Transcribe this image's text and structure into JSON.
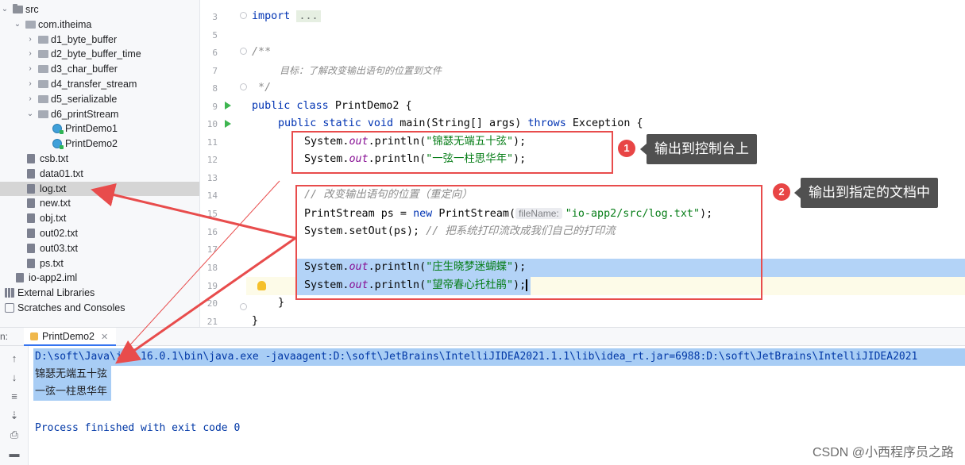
{
  "tree": {
    "items": [
      {
        "label": "src",
        "icon": "folder",
        "arrow": "v"
      },
      {
        "label": "com.itheima",
        "icon": "package",
        "arrow": "v"
      },
      {
        "label": "d1_byte_buffer",
        "icon": "package",
        "arrow": ">"
      },
      {
        "label": "d2_byte_buffer_time",
        "icon": "package",
        "arrow": ">"
      },
      {
        "label": "d3_char_buffer",
        "icon": "package",
        "arrow": ">"
      },
      {
        "label": "d4_transfer_stream",
        "icon": "package",
        "arrow": ">"
      },
      {
        "label": "d5_serializable",
        "icon": "package",
        "arrow": ">"
      },
      {
        "label": "d6_printStream",
        "icon": "package",
        "arrow": "v"
      },
      {
        "label": "PrintDemo1",
        "icon": "class"
      },
      {
        "label": "PrintDemo2",
        "icon": "class"
      },
      {
        "label": "csb.txt",
        "icon": "file"
      },
      {
        "label": "data01.txt",
        "icon": "file"
      },
      {
        "label": "log.txt",
        "icon": "file",
        "selected": true
      },
      {
        "label": "new.txt",
        "icon": "file"
      },
      {
        "label": "obj.txt",
        "icon": "file"
      },
      {
        "label": "out02.txt",
        "icon": "file"
      },
      {
        "label": "out03.txt",
        "icon": "file"
      },
      {
        "label": "ps.txt",
        "icon": "file"
      },
      {
        "label": "io-app2.iml",
        "icon": "file"
      },
      {
        "label": "External Libraries",
        "icon": "library",
        "arrow": ">"
      },
      {
        "label": "Scratches and Consoles",
        "icon": "scratch",
        "arrow": ">"
      }
    ]
  },
  "editor": {
    "line_numbers": [
      "3",
      "5",
      "6",
      "7",
      "8",
      "9",
      "10",
      "11",
      "12",
      "13",
      "14",
      "15",
      "16",
      "17",
      "18",
      "19",
      "20",
      "21"
    ],
    "lines": {
      "l3_import": "import ",
      "l3_fold": "...",
      "l6": "/**",
      "l7": "目标：了解改变输出语句的位置到文件",
      "l8": " */",
      "l9_kw": "public class ",
      "l9_rest": "PrintDemo2 {",
      "l10_kw1": "public static void ",
      "l10_mid": "main(String[] args) ",
      "l10_kw2": "throws ",
      "l10_rest": "Exception {",
      "sys": "System.",
      "out": "out",
      "println": ".println(",
      "s11": "\"锦瑟无端五十弦\"",
      "s12": "\"一弦一柱思华年\"",
      "end": ");",
      "l14": "// 改变输出语句的位置（重定向）",
      "l15_a": "PrintStream ps = ",
      "l15_new": "new ",
      "l15_b": "PrintStream(",
      "l15_hint": "fileName:",
      "l15_str": "\"io-app2/src/log.txt\"",
      "l16_a": "System.setOut(ps); ",
      "l16_cm": "// 把系统打印流改成我们自己的打印流",
      "s18": "\"庄生晓梦迷蝴蝶\"",
      "s19": "\"望帝春心托杜鹃\"",
      "l20": "}",
      "l21": "}"
    }
  },
  "annotations": {
    "badge1": "1",
    "tip1": "输出到控制台上",
    "badge2": "2",
    "tip2": "输出到指定的文档中"
  },
  "run": {
    "label": "n:",
    "tab": "PrintDemo2",
    "console": [
      "D:\\soft\\Java\\jdk-16.0.1\\bin\\java.exe -javaagent:D:\\soft\\JetBrains\\IntelliJIDEA2021.1.1\\lib\\idea_rt.jar=6988:D:\\soft\\JetBrains\\IntelliJIDEA2021",
      "锦瑟无端五十弦",
      "一弦一柱思华年",
      "",
      "Process finished with exit code 0"
    ]
  },
  "watermark": "CSDN @小西程序员之路",
  "colors": {
    "annotation_red": "#e84c4c",
    "selection": "#a8cdf5",
    "keyword": "#0033b3",
    "string": "#067d17"
  }
}
